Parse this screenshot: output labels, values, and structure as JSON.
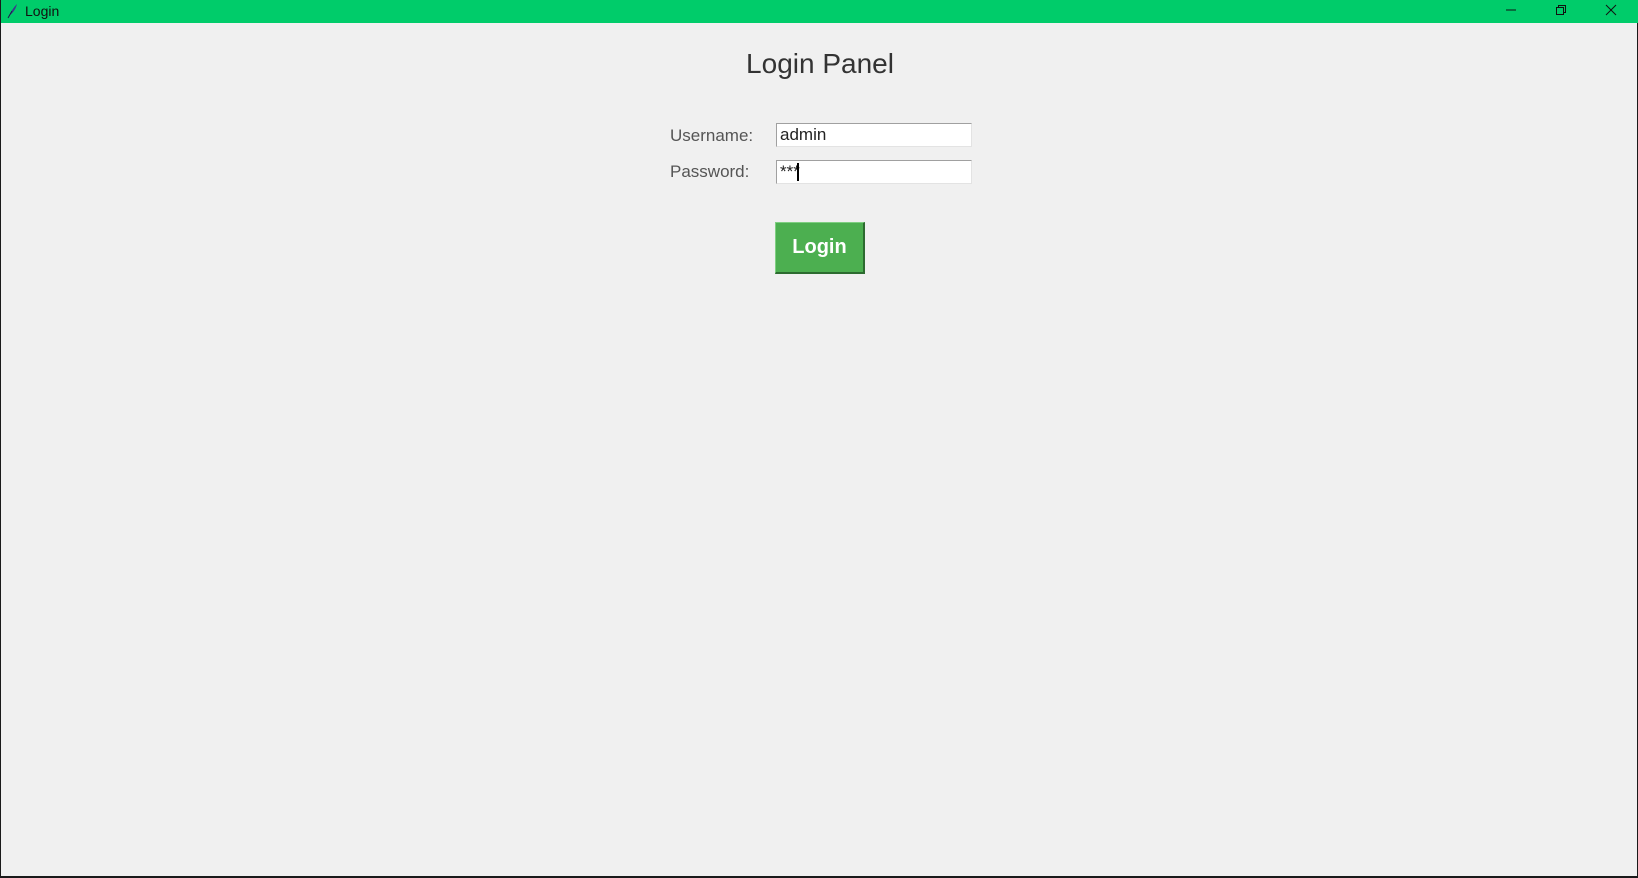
{
  "window": {
    "title": "Login",
    "title_bar_color": "#00cc6a",
    "controls": {
      "minimize_icon": "minimize-icon",
      "maximize_icon": "restore-icon",
      "close_icon": "close-icon"
    }
  },
  "login_panel": {
    "heading": "Login Panel",
    "username": {
      "label": "Username:",
      "value": "admin"
    },
    "password": {
      "label": "Password:",
      "value": "***"
    },
    "submit_label": "Login",
    "button_color": "#4caf50"
  }
}
